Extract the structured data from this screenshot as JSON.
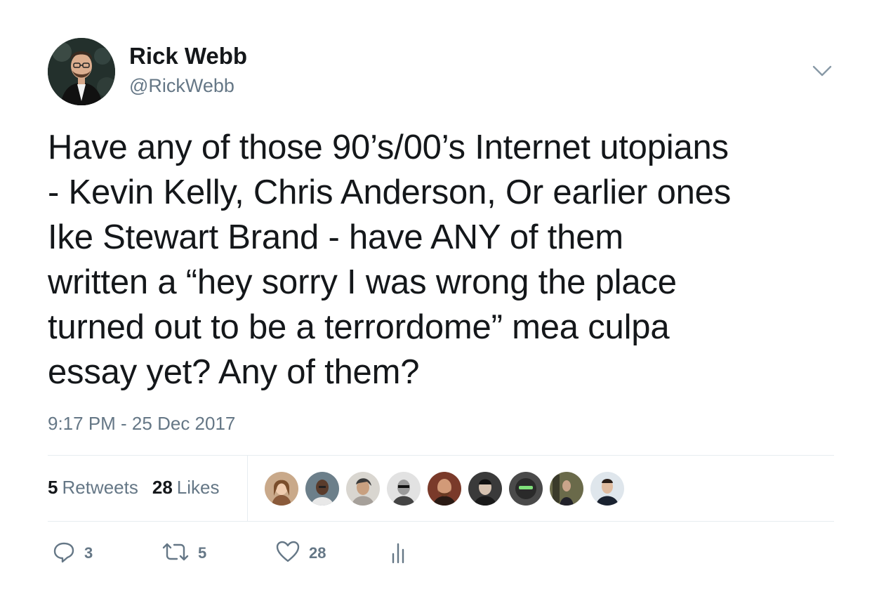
{
  "user": {
    "display_name": "Rick Webb",
    "handle": "@RickWebb"
  },
  "tweet": {
    "text": "Have any of those 90’s/00’s Internet utopians\n- Kevin Kelly, Chris Anderson, Or earlier ones\nIke Stewart Brand - have ANY of them\nwritten a “hey sorry I was wrong the place\nturned out to be a terrordome” mea culpa\nessay yet? Any of them?",
    "timestamp": "9:17 PM - 25 Dec 2017"
  },
  "stats": {
    "retweets_count": "5",
    "retweets_label": "Retweets",
    "likes_count": "28",
    "likes_label": "Likes"
  },
  "likers": [
    {
      "icon": "liker-avatar-1"
    },
    {
      "icon": "liker-avatar-2"
    },
    {
      "icon": "liker-avatar-3"
    },
    {
      "icon": "liker-avatar-4"
    },
    {
      "icon": "liker-avatar-5"
    },
    {
      "icon": "liker-avatar-6"
    },
    {
      "icon": "liker-avatar-7"
    },
    {
      "icon": "liker-avatar-8"
    },
    {
      "icon": "liker-avatar-9"
    }
  ],
  "actions": {
    "reply_count": "3",
    "retweet_count": "5",
    "like_count": "28"
  },
  "icons": {
    "more": "chevron-down-icon",
    "reply": "reply-icon",
    "retweet": "retweet-icon",
    "like": "heart-icon",
    "analytics": "analytics-icon"
  },
  "colors": {
    "text": "#14171a",
    "secondary": "#657786",
    "divider": "#e6ecf0",
    "icon": "#657786"
  }
}
